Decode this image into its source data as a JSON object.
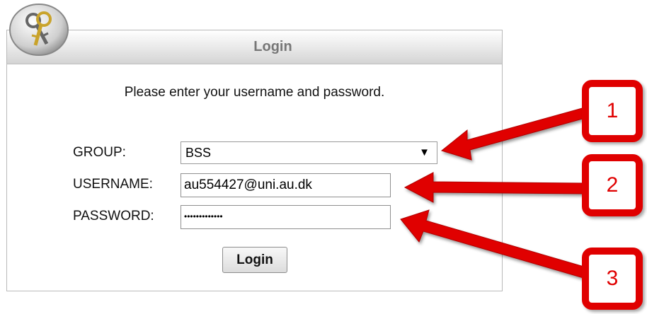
{
  "dialog": {
    "title": "Login",
    "prompt": "Please enter your username and password."
  },
  "form": {
    "group_label": "GROUP:",
    "group_value": "BSS",
    "username_label": "USERNAME:",
    "username_value": "au554427@uni.au.dk",
    "password_label": "PASSWORD:",
    "password_value": "•••••••••••••",
    "login_label": "Login"
  },
  "callouts": [
    "1",
    "2",
    "3"
  ],
  "colors": {
    "callout_red": "#e00000"
  },
  "icons": {
    "dialog_icon": "keys-icon",
    "select_arrow": "triangle-down-icon"
  }
}
